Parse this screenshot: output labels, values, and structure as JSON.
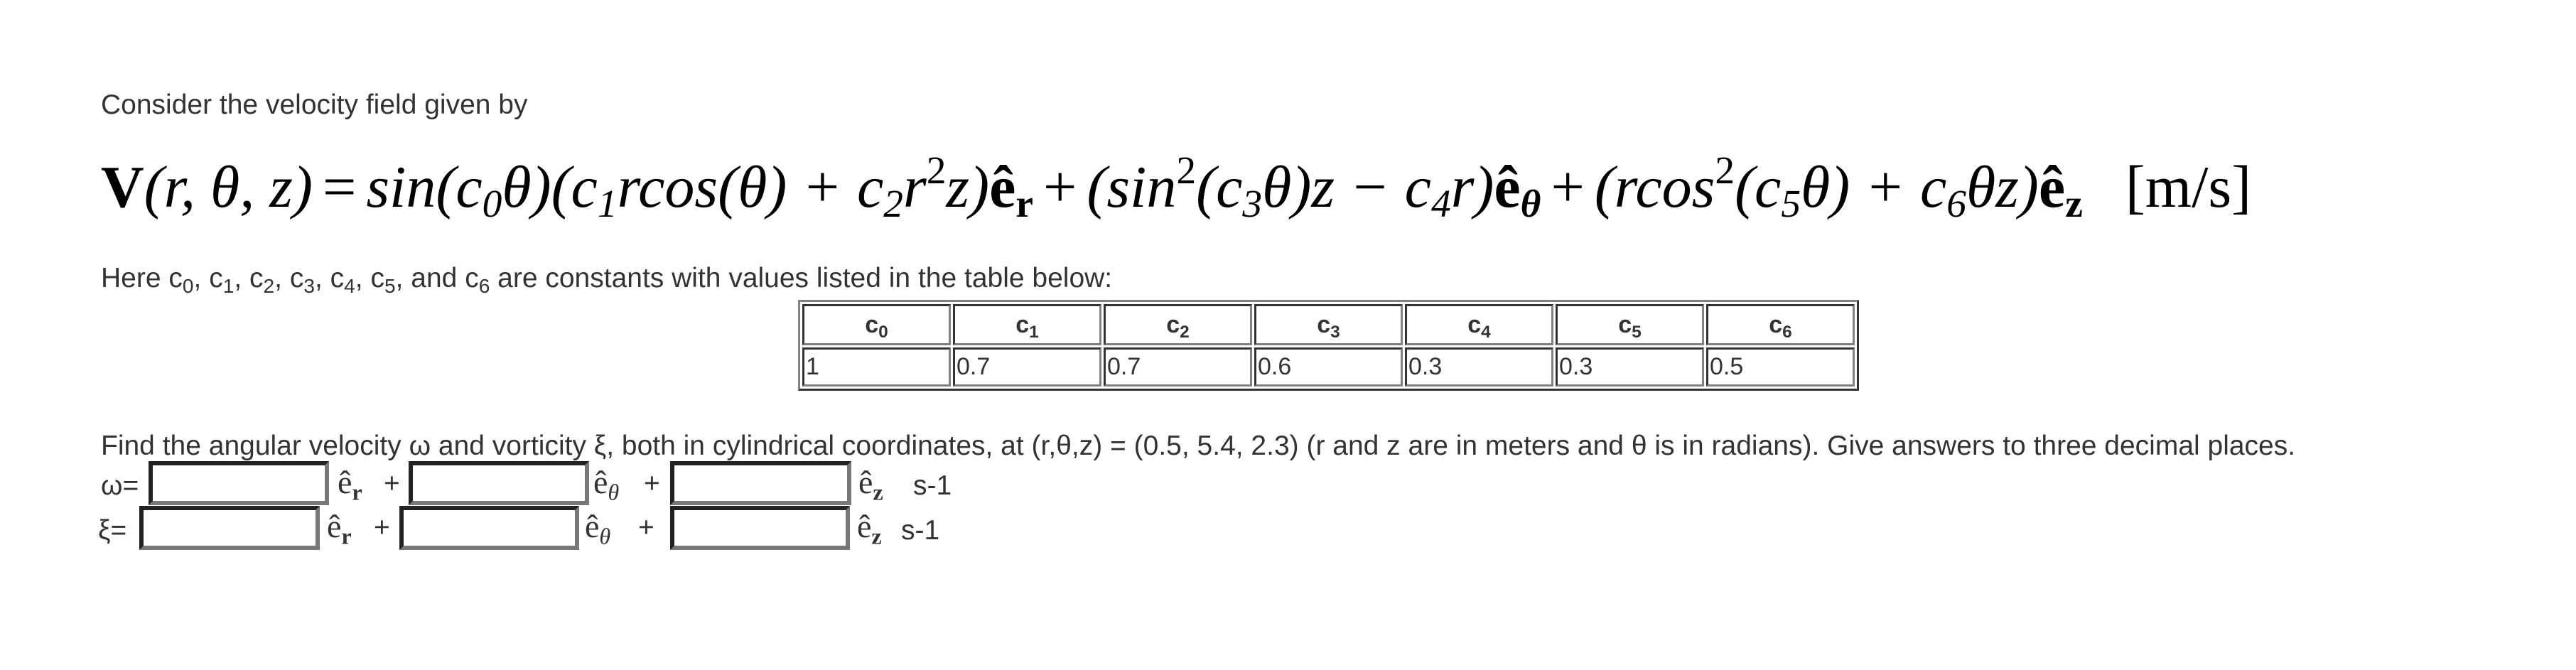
{
  "intro": "Consider the velocity field given by",
  "equation": {
    "lhs_vector": "V",
    "lhs_args": "(r, θ, z)",
    "equals": "=",
    "term_r": {
      "prefix": "sin(c",
      "c_index": "0",
      "mid": "θ)(c",
      "c1_index": "1",
      "mid2": "rcos(θ) + c",
      "c2_index": "2",
      "tail": "r",
      "power": "2",
      "end": "z)",
      "unit_vector": "ê",
      "unit_sub": "r"
    },
    "term_theta": {
      "prefix": "(sin",
      "power": "2",
      "mid": "(c",
      "c_index": "3",
      "mid2": "θ)z − c",
      "c4_index": "4",
      "end": "r)",
      "unit_vector": "ê",
      "unit_sub": "θ"
    },
    "term_z": {
      "prefix": "(rcos",
      "power": "2",
      "mid": "(c",
      "c_index": "5",
      "mid2": "θ) + c",
      "c6_index": "6",
      "end": "θz)",
      "unit_vector": "ê",
      "unit_sub": "z"
    },
    "plus": "+",
    "units": "[m/s]"
  },
  "constants_sentence": {
    "before": "Here",
    "list": [
      "0",
      "1",
      "2",
      "3",
      "4",
      "5"
    ],
    "and": "and",
    "last": "6",
    "after": "are constants with values listed in the table below:"
  },
  "constants_table": {
    "headers": [
      "0",
      "1",
      "2",
      "3",
      "4",
      "5",
      "6"
    ],
    "values": [
      "1",
      "0.7",
      "0.7",
      "0.6",
      "0.3",
      "0.3",
      "0.5"
    ]
  },
  "question": "Find the angular velocity ω and vorticity ξ, both in cylindrical coordinates, at (r,θ,z) = (0.5, 5.4, 2.3) (r and z are in meters and θ is in radians). Give answers to three decimal places.",
  "answers": {
    "omega": {
      "label": "ω=",
      "fields": [
        {
          "value": "",
          "unit": "ê",
          "sub": "r"
        },
        {
          "value": "",
          "unit": "ê",
          "sub": "θ"
        },
        {
          "value": "",
          "unit": "ê",
          "sub": "z"
        }
      ],
      "plus": "+",
      "units": "s-1"
    },
    "xi": {
      "label": "ξ=",
      "fields": [
        {
          "value": "",
          "unit": "ê",
          "sub": "r"
        },
        {
          "value": "",
          "unit": "ê",
          "sub": "θ"
        },
        {
          "value": "",
          "unit": "ê",
          "sub": "z"
        }
      ],
      "plus": "+",
      "units": "s-1"
    }
  }
}
